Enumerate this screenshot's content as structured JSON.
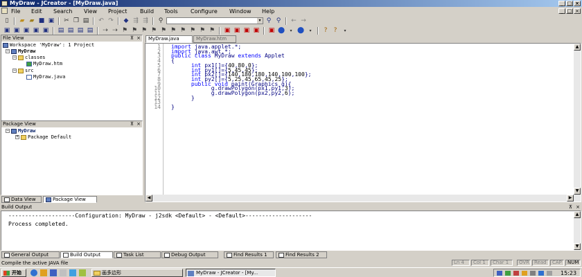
{
  "window": {
    "title": "MyDraw - JCreator - [MyDraw.java]",
    "controls": [
      "_",
      "□",
      "×"
    ]
  },
  "menu": [
    {
      "label": "File"
    },
    {
      "label": "Edit"
    },
    {
      "label": "Search"
    },
    {
      "label": "View"
    },
    {
      "label": "Project"
    },
    {
      "label": "Build"
    },
    {
      "label": "Tools"
    },
    {
      "label": "Configure"
    },
    {
      "label": "Window"
    },
    {
      "label": "Help"
    }
  ],
  "file_view": {
    "header": "File View",
    "tree": [
      {
        "label": "Workspace 'MyDraw': 1 Project"
      },
      {
        "label": "MyDraw"
      },
      {
        "label": "classes"
      },
      {
        "label": "MyDraw.htm"
      },
      {
        "label": "src"
      },
      {
        "label": "MyDraw.java"
      }
    ]
  },
  "package_view": {
    "header": "Package View",
    "tree": [
      {
        "label": "MyDraw"
      },
      {
        "label": "Package Default"
      }
    ]
  },
  "left_tabs": [
    {
      "label": "Data View"
    },
    {
      "label": "Package View"
    }
  ],
  "editor": {
    "tabs": [
      {
        "label": "MyDraw.java"
      },
      {
        "label": "MyDraw.htm"
      }
    ],
    "lines": [
      {
        "n": "1",
        "code": "import java.applet.*;"
      },
      {
        "n": "2",
        "code": "import java.awt.*;"
      },
      {
        "n": "3",
        "code": "public class MyDraw extends Applet"
      },
      {
        "n": "4",
        "code": "{"
      },
      {
        "n": "5",
        "code": "      int px1[]={40,80,0};"
      },
      {
        "n": "6",
        "code": "      int py1[]={5,45,45};"
      },
      {
        "n": "7",
        "code": "      int px2[]={140,180,180,140,100,100};"
      },
      {
        "n": "8",
        "code": "      int py2[]={5,25,45,65,45,25};"
      },
      {
        "n": "9",
        "code": "      public void paint(Graphics g){"
      },
      {
        "n": "10",
        "code": "            g.drawPolygon(px1,py1,3);"
      },
      {
        "n": "11",
        "code": "            g.drawPolygon(px2,py2,6);"
      },
      {
        "n": "12",
        "code": "      }"
      },
      {
        "n": "13",
        "code": ""
      },
      {
        "n": "14",
        "code": "}"
      }
    ]
  },
  "build_output": {
    "header": "Build Output",
    "config_line": "--------------------Configuration: MyDraw - j2sdk <Default> - <Default>--------------------",
    "result_line": "Process completed."
  },
  "output_tabs": [
    {
      "label": "General Output"
    },
    {
      "label": "Build Output"
    },
    {
      "label": "Task List"
    },
    {
      "label": "Debug Output"
    },
    {
      "label": "Find Results 1"
    },
    {
      "label": "Find Results 2"
    }
  ],
  "status": {
    "message": "Compile the active JAVA file",
    "ln": "Ln 4",
    "col": "Col 1",
    "char": "Char 1",
    "ovr": "OVR",
    "read": "Read",
    "cap": "CAP",
    "num": "NUM"
  },
  "taskbar": {
    "start": "开始",
    "task1": "画多边形",
    "task2": "MyDraw - JCreator - [My...",
    "clock": "15:23"
  },
  "colors": {
    "keyword": "#0000ff",
    "title_start": "#0a246a",
    "title_end": "#a6caf0"
  }
}
